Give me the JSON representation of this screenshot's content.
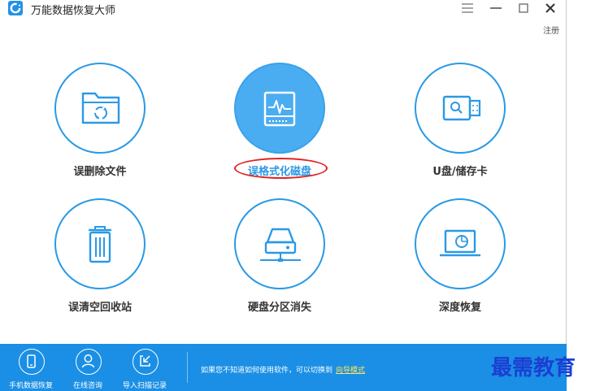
{
  "window": {
    "title": "万能数据恢复大师",
    "register_label": "注册"
  },
  "features": [
    {
      "label": "误删除文件",
      "icon": "folder-recycle-icon",
      "active": false
    },
    {
      "label": "误格式化磁盘",
      "icon": "disk-format-icon",
      "active": true
    },
    {
      "label": "U盘/储存卡",
      "icon": "usb-drive-icon",
      "active": false
    },
    {
      "label": "误清空回收站",
      "icon": "trash-bin-icon",
      "active": false
    },
    {
      "label": "硬盘分区消失",
      "icon": "hard-disk-partition-icon",
      "active": false
    },
    {
      "label": "深度恢复",
      "icon": "laptop-scan-icon",
      "active": false
    }
  ],
  "bottom_bar": {
    "items": [
      {
        "label": "手机数据恢复",
        "icon": "phone-icon"
      },
      {
        "label": "在线咨询",
        "icon": "user-support-icon"
      },
      {
        "label": "导入扫描记录",
        "icon": "import-icon"
      }
    ],
    "hint_text": "如果您不知道如何使用软件，可以切换到",
    "hint_link": "向导模式"
  },
  "watermark": "最需教育",
  "colors": {
    "accent": "#2a99e6",
    "active_fill": "#4aadf1",
    "bottom_bar": "#1a8fe5",
    "highlight": "#e02424",
    "link": "#ffe45c",
    "watermark": "#1c3fd2"
  }
}
